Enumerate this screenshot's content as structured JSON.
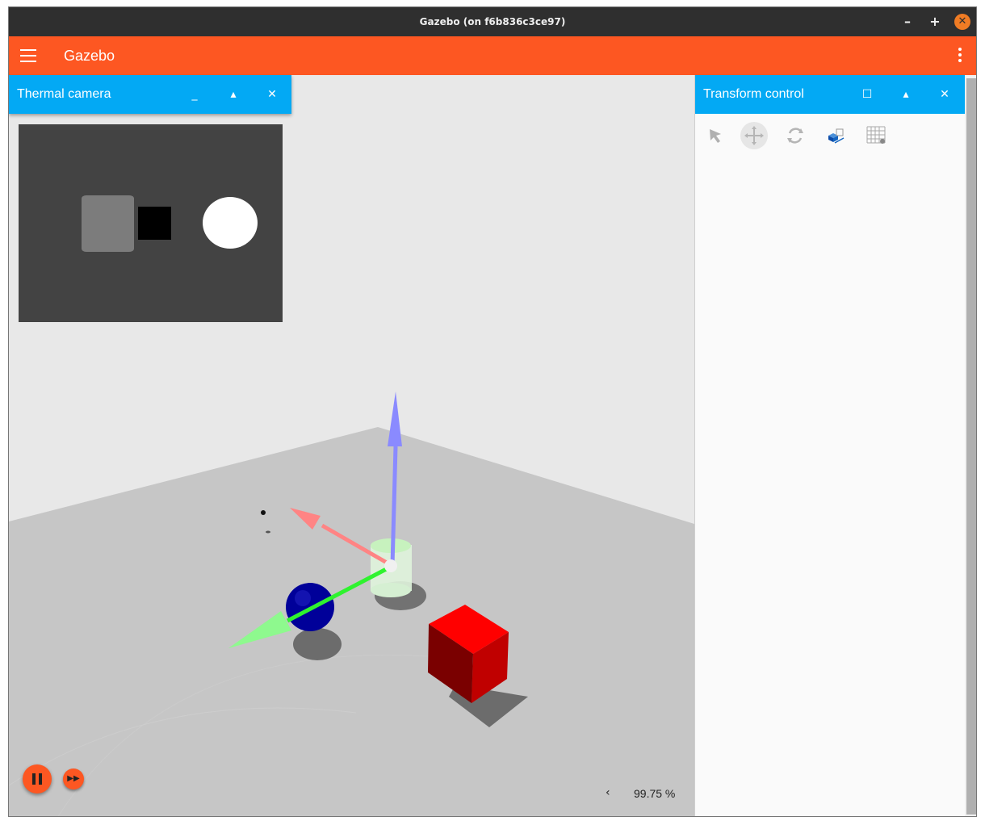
{
  "window": {
    "title": "Gazebo (on f6b836c3ce97)",
    "minimize": "–",
    "maximize": "+",
    "close": "✕"
  },
  "appbar": {
    "title": "Gazebo",
    "menu_icon": "hamburger-menu-icon",
    "more_icon": "more-vert-icon"
  },
  "thermal_camera": {
    "title": "Thermal camera",
    "btn_min": "_",
    "btn_float": "▴",
    "btn_close": "✕"
  },
  "transform_control": {
    "title": "Transform control",
    "btn_max": "☐",
    "btn_float": "▴",
    "btn_close": "✕",
    "tools": [
      "select-mode-icon",
      "translate-mode-icon",
      "rotate-mode-icon",
      "snap-icon",
      "grid-snap-icon"
    ]
  },
  "playback": {
    "pause_icon": "pause-icon",
    "step_icon": "fast-forward-icon"
  },
  "status": {
    "rtf_arrow": "‹",
    "real_time_factor": "99.75 %"
  },
  "colors": {
    "appbar": "#fd5722",
    "panel_header": "#03a9f4",
    "titlebar": "#2f2f2f"
  }
}
